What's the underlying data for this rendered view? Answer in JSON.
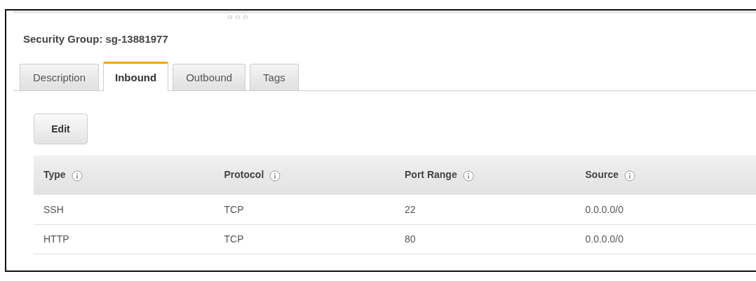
{
  "panel": {
    "title": "Security Group: sg-13881977"
  },
  "tabs": [
    {
      "label": "Description",
      "selected": false
    },
    {
      "label": "Inbound",
      "selected": true
    },
    {
      "label": "Outbound",
      "selected": false
    },
    {
      "label": "Tags",
      "selected": false
    }
  ],
  "buttons": [
    "Edit"
  ],
  "table": {
    "columns": [
      "Type",
      "Protocol",
      "Port Range",
      "Source"
    ],
    "rows": [
      [
        "SSH",
        "TCP",
        "22",
        "0.0.0.0/0"
      ],
      [
        "HTTP",
        "TCP",
        "80",
        "0.0.0.0/0"
      ]
    ]
  }
}
